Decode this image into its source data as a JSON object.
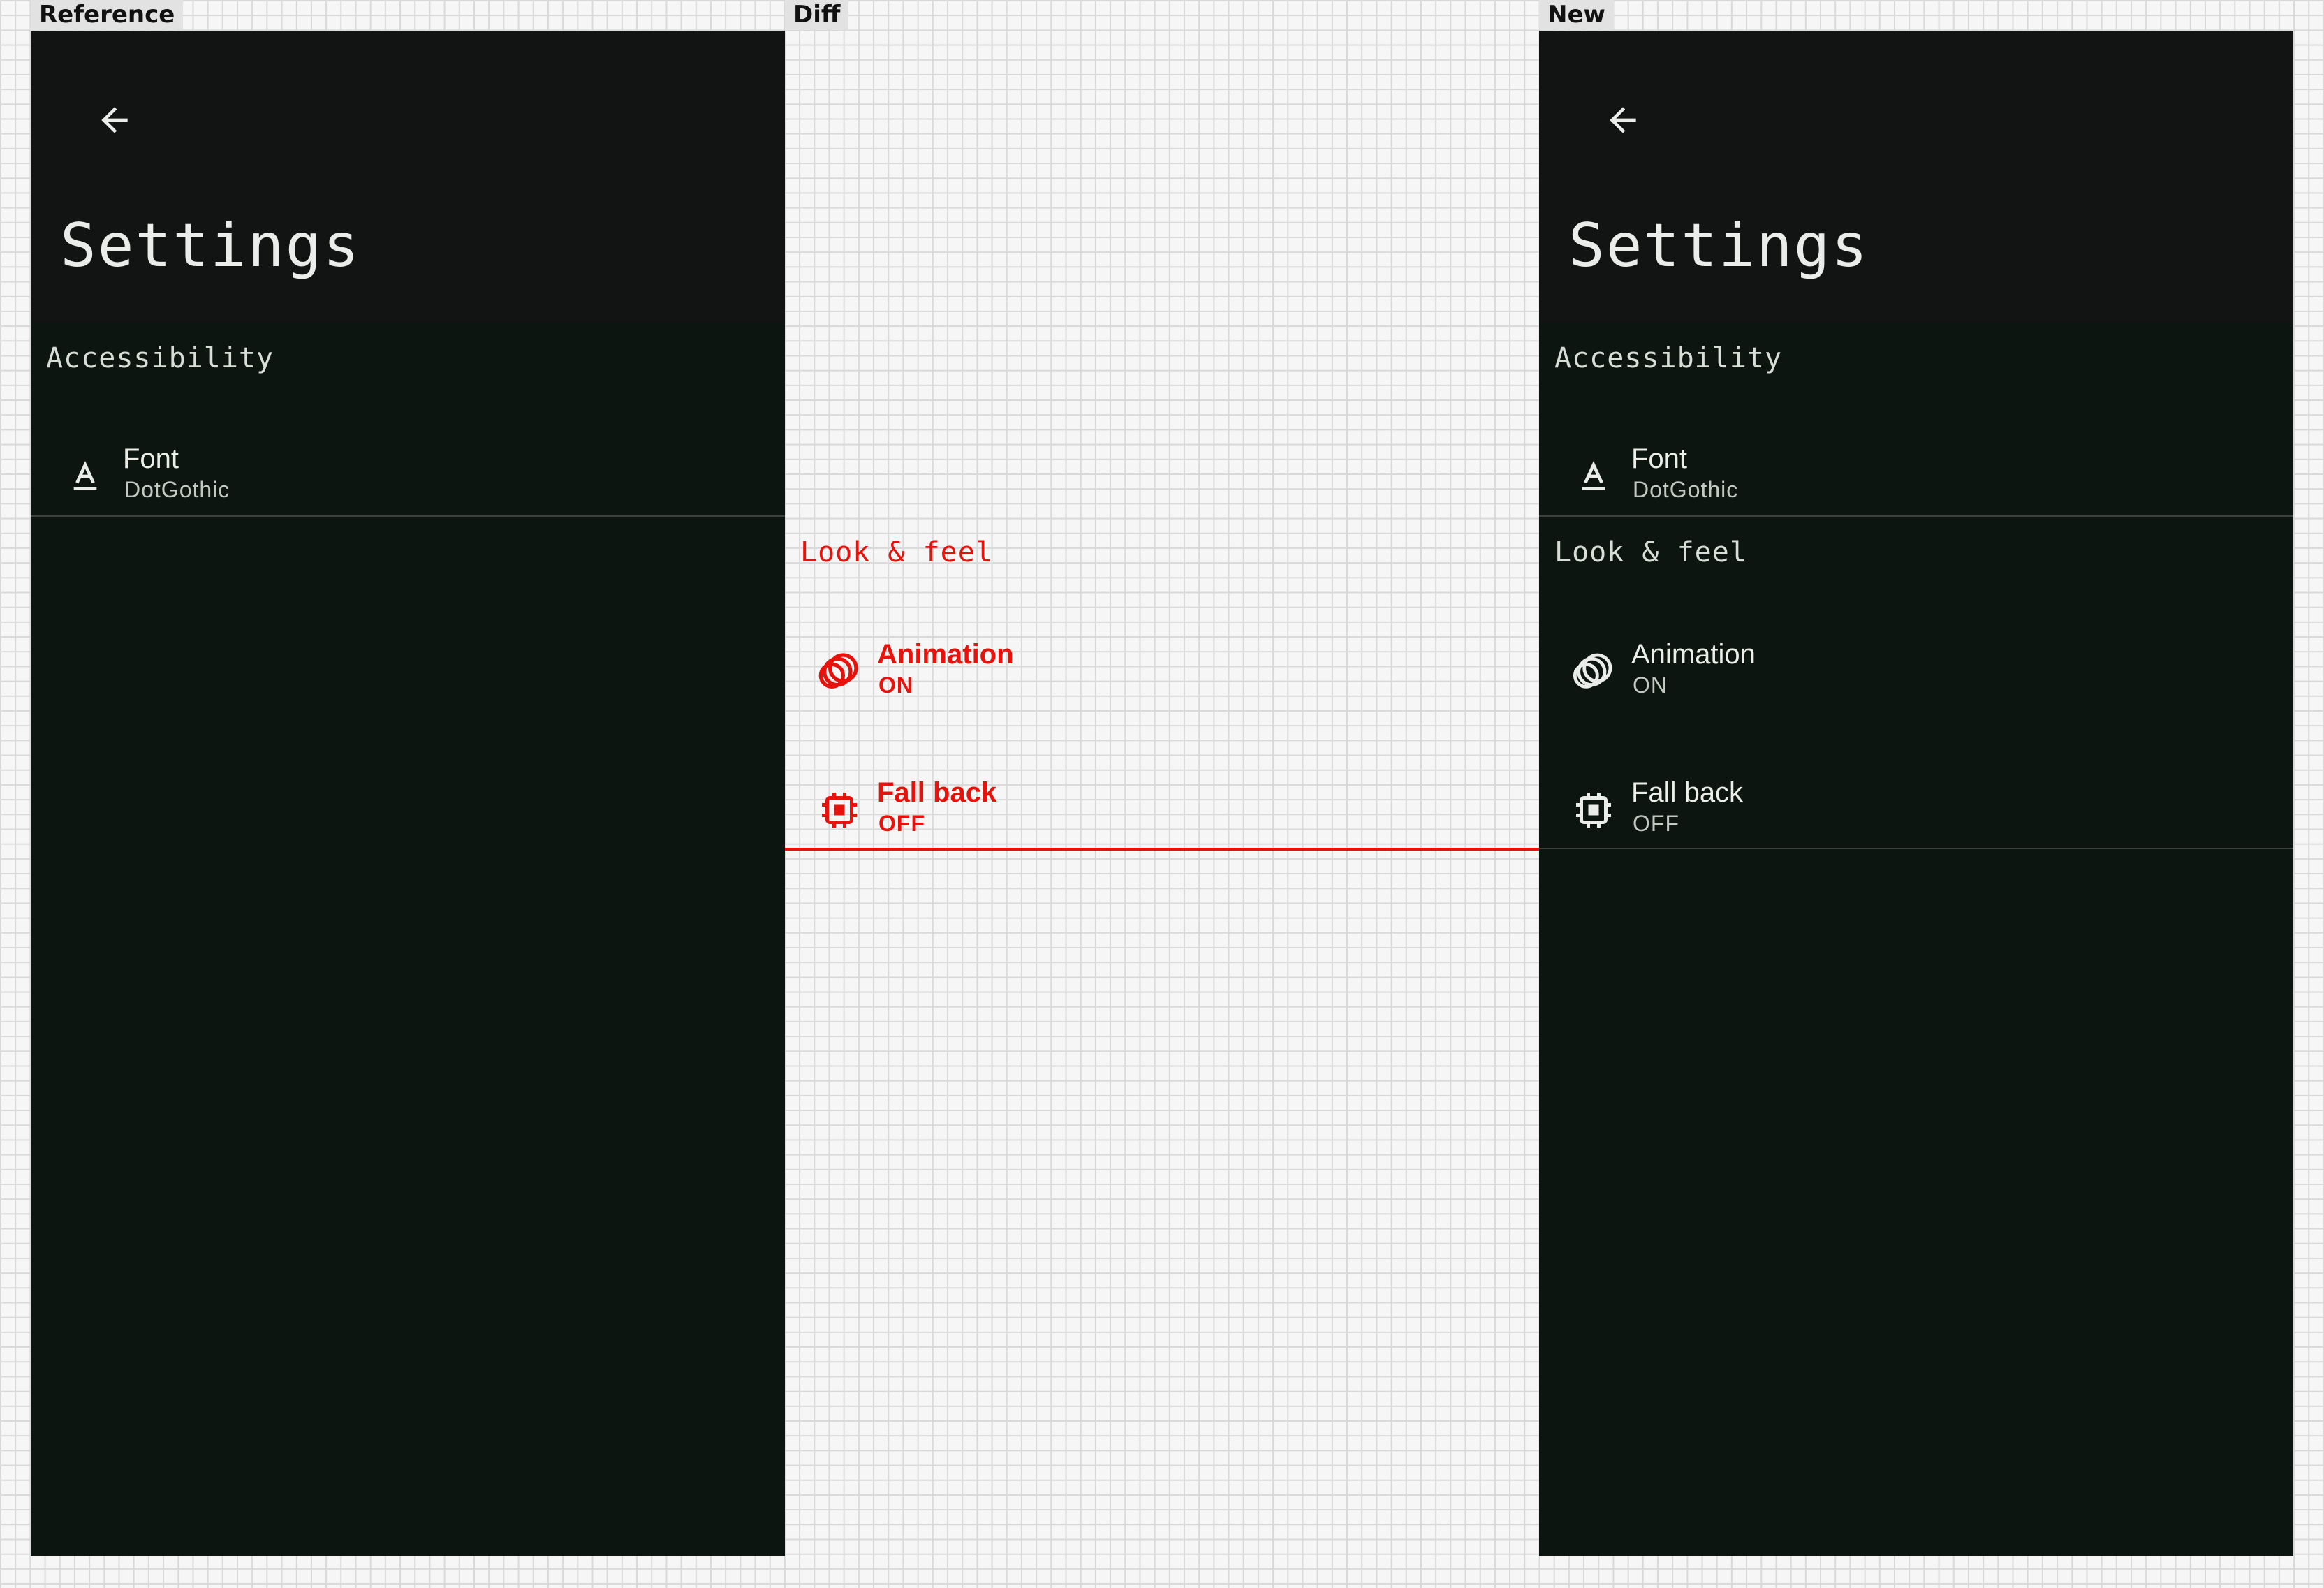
{
  "labels": {
    "reference": "Reference",
    "diff": "Diff",
    "new": "New"
  },
  "screen": {
    "title": "Settings",
    "accessibility_header": "Accessibility",
    "font_title": "Font",
    "font_value": "DotGothic",
    "look_header": "Look & feel",
    "animation_title": "Animation",
    "animation_value": "ON",
    "fallback_title": "Fall back",
    "fallback_value": "OFF"
  },
  "icons": {
    "back": "arrow-back-icon",
    "font": "font-letter-icon",
    "animation": "animation-rings-icon",
    "fallback": "chip-icon"
  },
  "colors": {
    "appbar": "#111413",
    "surface": "#0c150f",
    "text": "#eceeea",
    "diff": "#e8120c"
  }
}
